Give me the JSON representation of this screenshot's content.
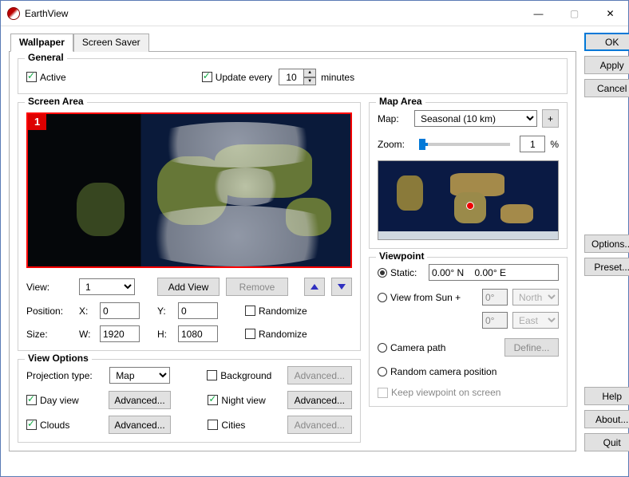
{
  "window": {
    "title": "EarthView"
  },
  "tabs": {
    "wallpaper": "Wallpaper",
    "screensaver": "Screen Saver"
  },
  "buttons": {
    "ok": "OK",
    "apply": "Apply",
    "cancel": "Cancel",
    "options": "Options...",
    "preset": "Preset...",
    "help": "Help",
    "about": "About...",
    "quit": "Quit"
  },
  "general": {
    "legend": "General",
    "active_label": "Active",
    "update_every_label": "Update every",
    "update_minutes": "10",
    "minutes_label": "minutes"
  },
  "screen_area": {
    "legend": "Screen Area",
    "screen_number": "1",
    "view_label": "View:",
    "view_value": "1",
    "add_view": "Add View",
    "remove": "Remove",
    "position_label": "Position:",
    "x_label": "X:",
    "x_value": "0",
    "y_label": "Y:",
    "y_value": "0",
    "randomize_label": "Randomize",
    "size_label": "Size:",
    "w_label": "W:",
    "w_value": "1920",
    "h_label": "H:",
    "h_value": "1080"
  },
  "view_options": {
    "legend": "View Options",
    "projection_label": "Projection type:",
    "projection_value": "Map",
    "background_label": "Background",
    "advanced": "Advanced...",
    "day_view_label": "Day view",
    "night_view_label": "Night view",
    "clouds_label": "Clouds",
    "cities_label": "Cities"
  },
  "map_area": {
    "legend": "Map Area",
    "map_label": "Map:",
    "map_value": "Seasonal (10 km)",
    "add_button": "+",
    "zoom_label": "Zoom:",
    "zoom_value": "1",
    "percent": "%"
  },
  "viewpoint": {
    "legend": "Viewpoint",
    "static_label": "Static:",
    "static_coords": "0.00° N    0.00° E",
    "sun_label": "View from Sun +",
    "deg0": "0°",
    "north": "North",
    "east": "East",
    "camera_path_label": "Camera path",
    "define": "Define...",
    "random_label": "Random camera position",
    "keep_label": "Keep viewpoint on screen"
  }
}
